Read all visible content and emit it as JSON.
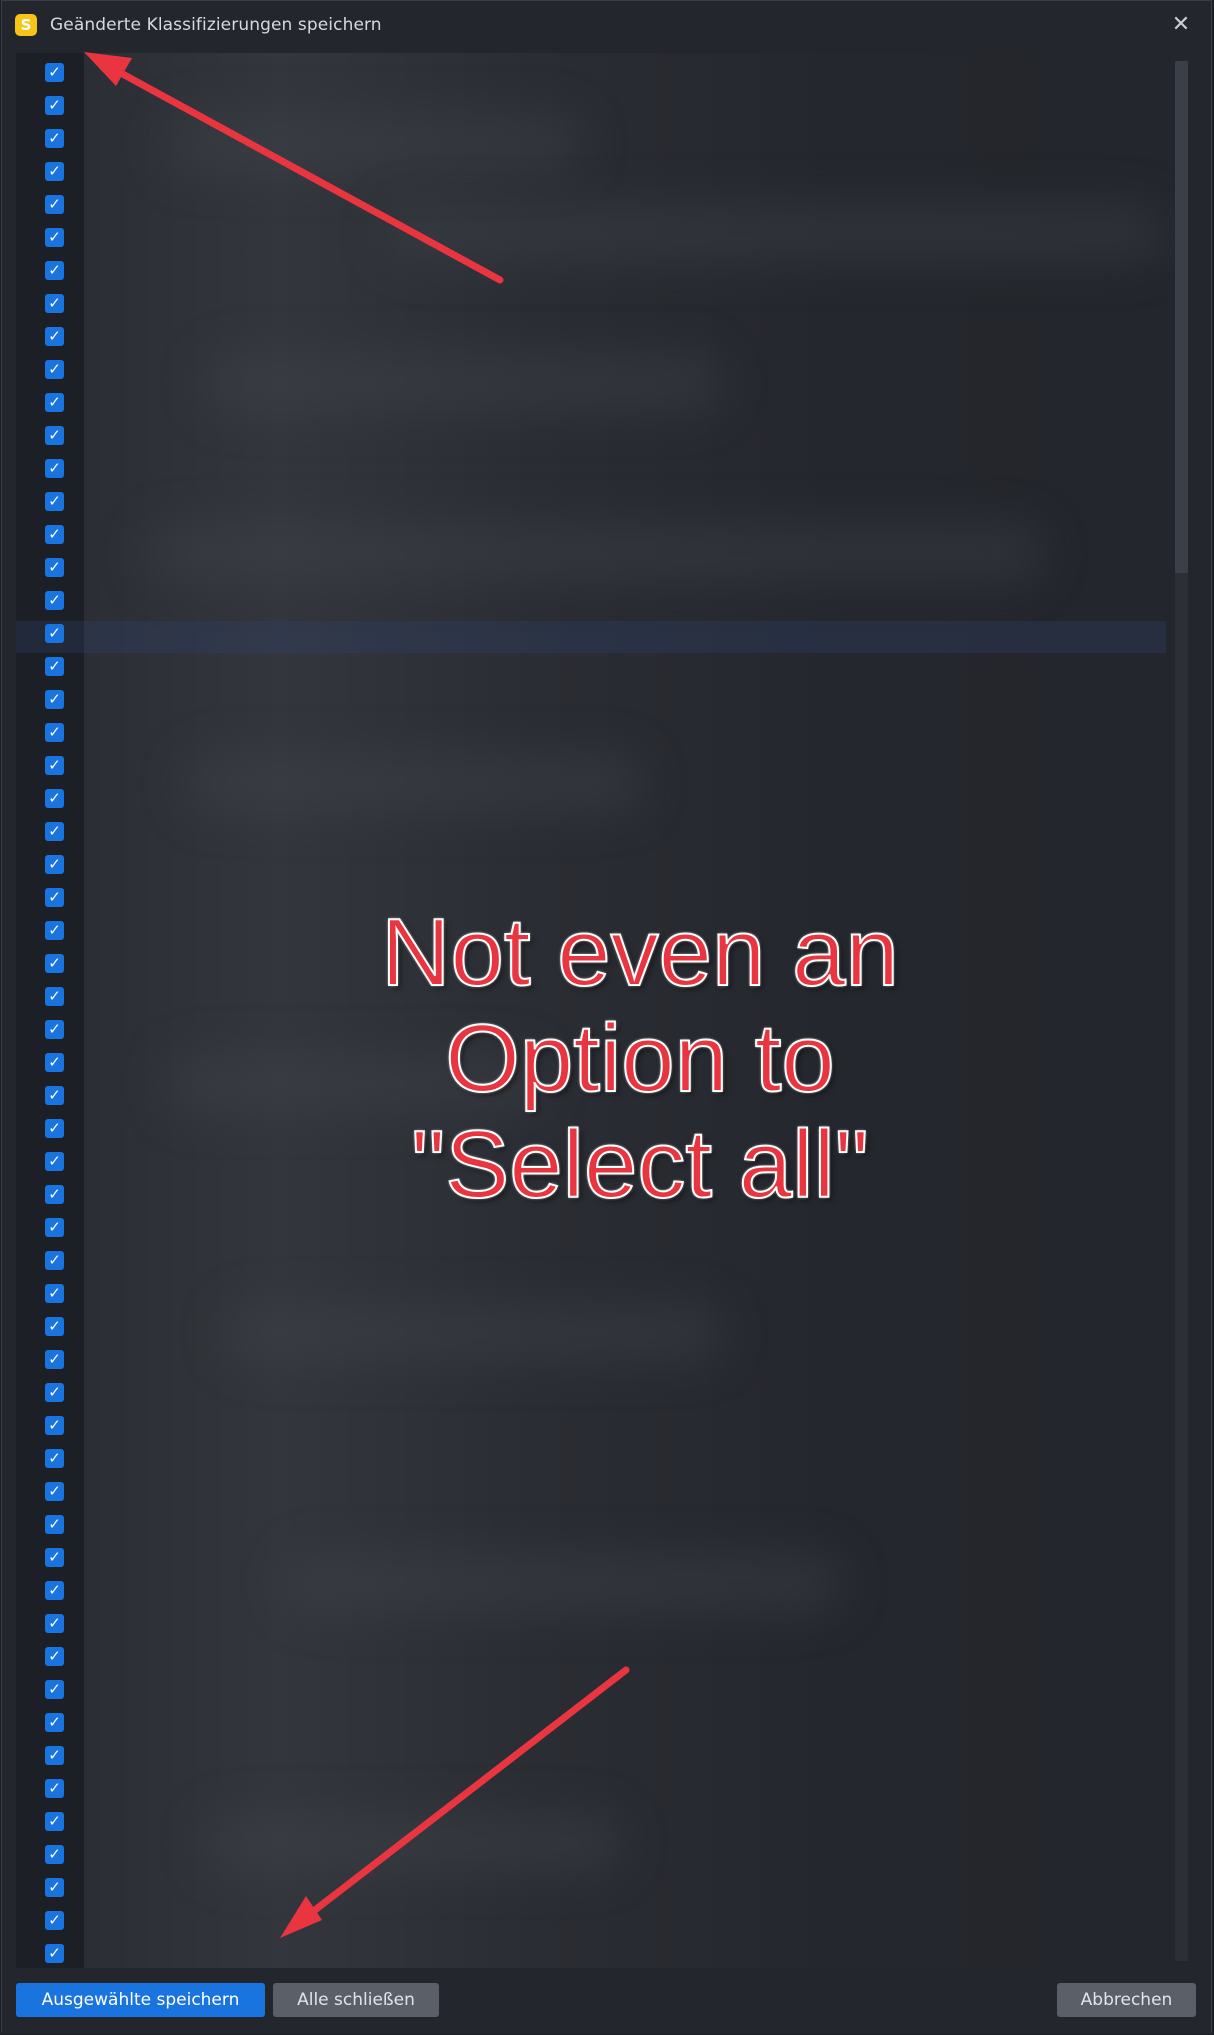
{
  "window": {
    "title": "Geänderte Klassifizierungen speichern",
    "app_icon_letter": "S",
    "close_glyph": "✕"
  },
  "list": {
    "checkbox_glyph": "✓",
    "rows_visible": 58,
    "all_checked": true,
    "highlighted_row_index": 17
  },
  "footer": {
    "save_selected_label": "Ausgewählte speichern",
    "close_all_label": "Alle schließen",
    "cancel_label": "Abbrechen"
  },
  "annotation": {
    "lines": [
      "Not even an",
      "Option to",
      "\"Select all\""
    ],
    "color": "#e8353f"
  },
  "colors": {
    "accent": "#1a74e0",
    "window_bg": "#23262d",
    "app_icon": "#f7c518"
  }
}
